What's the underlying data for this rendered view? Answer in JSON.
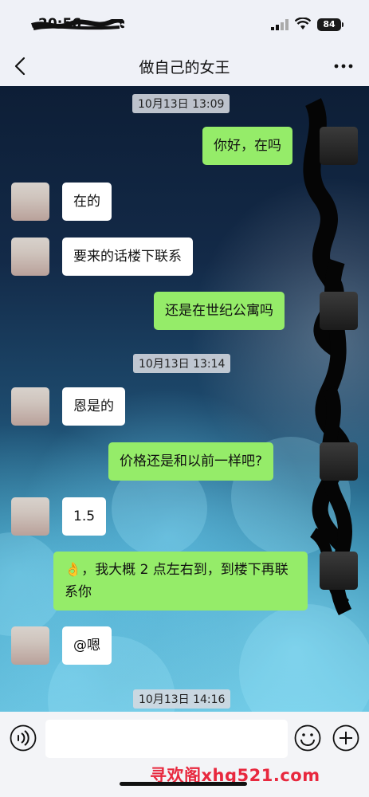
{
  "status": {
    "time": "20:56",
    "battery": "84"
  },
  "header": {
    "title": "做自己的女王"
  },
  "messages": {
    "ts1": "10月13日 13:09",
    "m1": "你好，在吗",
    "m2": "在的",
    "m3": "要来的话楼下联系",
    "m4": "还是在世纪公寓吗",
    "ts2": "10月13日 13:14",
    "m5": "恩是的",
    "m6": "价格还是和以前一样吧?",
    "m7": "1.5",
    "m8_emoji": "👌",
    "m8": "，我大概 2 点左右到，到楼下再联系你",
    "m9": "@嗯",
    "ts3": "10月13日 14:16"
  },
  "watermark": "寻欢阁xhg521.com",
  "colors": {
    "sent_bubble": "#95ec69",
    "received_bubble": "#ffffff",
    "watermark": "#e8283e"
  },
  "icons": [
    "back-icon",
    "more-icon",
    "voice-icon",
    "emoji-icon",
    "plus-icon",
    "signal-icon",
    "wifi-icon",
    "battery-icon"
  ]
}
